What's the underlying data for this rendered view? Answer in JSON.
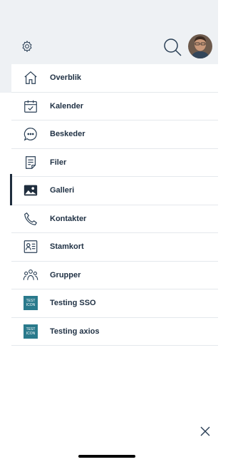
{
  "header": {
    "settings_icon": "gear-icon",
    "search_icon": "search-icon"
  },
  "menu": {
    "items": [
      {
        "label": "Overblik",
        "icon": "home-icon"
      },
      {
        "label": "Kalender",
        "icon": "calendar-icon"
      },
      {
        "label": "Beskeder",
        "icon": "message-icon"
      },
      {
        "label": "Filer",
        "icon": "file-icon"
      },
      {
        "label": "Galleri",
        "icon": "image-icon",
        "active": true
      },
      {
        "label": "Kontakter",
        "icon": "phone-icon"
      },
      {
        "label": "Stamkort",
        "icon": "contact-card-icon"
      },
      {
        "label": "Grupper",
        "icon": "group-icon"
      },
      {
        "label": "Testing SSO",
        "icon": "test-icon",
        "icon_text": [
          "TEST",
          "ICON"
        ]
      },
      {
        "label": "Testing axios",
        "icon": "test-icon",
        "icon_text": [
          "TEST",
          "ICON"
        ]
      }
    ]
  },
  "close_icon": "close-icon",
  "colors": {
    "text": "#213245",
    "active_indicator": "#1f2d3d",
    "test_icon_bg": "#2a7a8c",
    "top_band": "#eef1f4"
  }
}
